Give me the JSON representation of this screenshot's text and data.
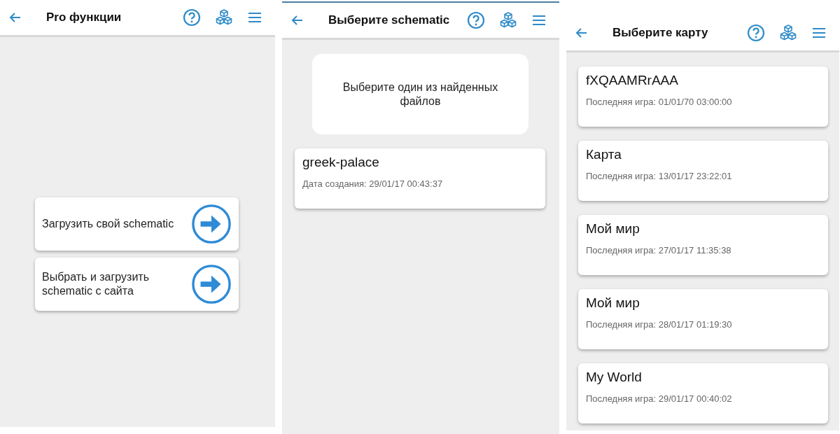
{
  "screens": [
    {
      "kind": "actions",
      "title": "Pro функции",
      "actions": [
        {
          "label": "Загрузить свой schematic"
        },
        {
          "label": "Выбрать и загрузить schematic с сайта"
        }
      ]
    },
    {
      "kind": "files",
      "title": "Выберите schematic",
      "notice": "Выберите один из найденных файлов",
      "items": [
        {
          "name": "greek-palace",
          "detail": "Дата создания: 29/01/17 00:43:37"
        }
      ]
    },
    {
      "kind": "maps",
      "title": "Выберите карту",
      "items": [
        {
          "name": "fXQAAMRrAAA",
          "detail": "Последняя игра: 01/01/70 03:00:00"
        },
        {
          "name": "Карта",
          "detail": "Последняя игра: 13/01/17 23:22:01"
        },
        {
          "name": "Мой мир",
          "detail": "Последняя игра: 27/01/17 11:35:38"
        },
        {
          "name": "Мой мир",
          "detail": "Последняя игра: 28/01/17 01:19:30"
        },
        {
          "name": "My World",
          "detail": "Последняя игра: 29/01/17 00:40:02"
        }
      ]
    }
  ]
}
